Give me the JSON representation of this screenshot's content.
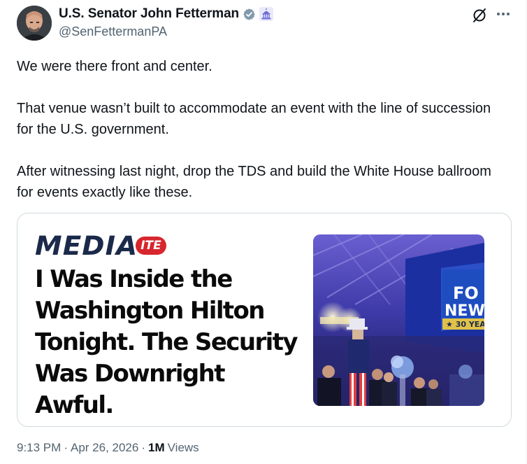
{
  "author": {
    "display_name": "U.S. Senator John Fetterman",
    "handle": "@SenFettermanPA",
    "verified_icon": "verified-check-icon",
    "affiliation_icon": "capitol-government-badge-icon"
  },
  "actions": {
    "grok_icon": "grok-icon",
    "more_icon": "more-options-icon"
  },
  "tweet": {
    "paragraphs": [
      "We were there front and center.",
      "That venue wasn’t built to accommodate an event with the line of succession for the U.S. government.",
      "After witnessing last night, drop the TDS and build the White House ballroom for events exactly like these."
    ]
  },
  "card": {
    "brand_main": "MEDIA",
    "brand_pill": "ITE",
    "headline": "I Was Inside the Washington Hilton Tonight. The Security Was Downright Awful.",
    "photo_sign_line1": "FO",
    "photo_sign_line2": "NEW",
    "photo_sign_line3": "★ 30 YEAR"
  },
  "meta": {
    "time": "9:13 PM",
    "separator": "·",
    "date": "Apr 26, 2026",
    "views_count": "1M",
    "views_label": "Views"
  },
  "colors": {
    "text_primary": "#0f1419",
    "text_secondary": "#536471",
    "verified": "#829aab",
    "gov_badge": "#6b6bd6",
    "brand_navy": "#1b2a4a",
    "brand_red": "#d7262e"
  }
}
